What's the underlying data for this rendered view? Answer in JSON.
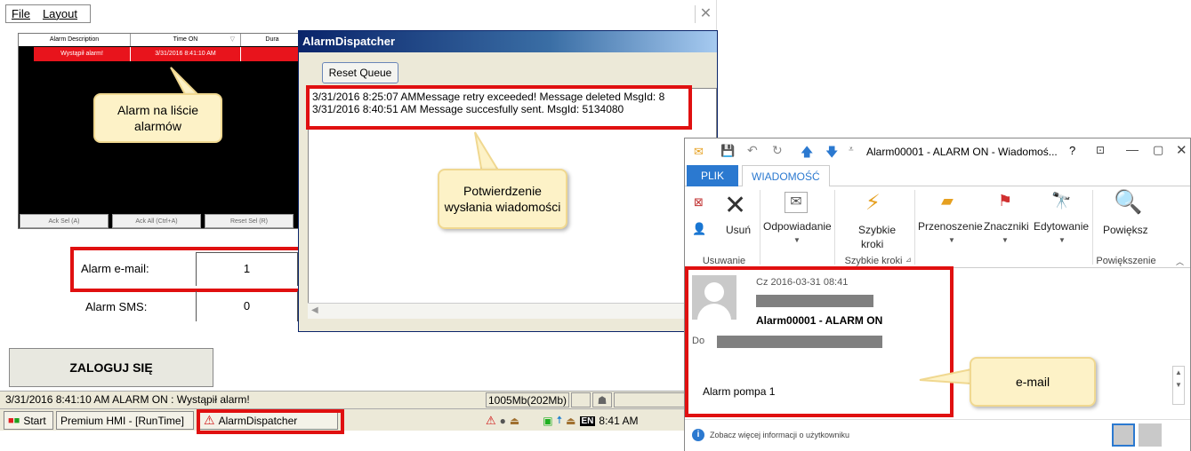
{
  "hmi": {
    "menu": {
      "file": "File",
      "layout": "Layout"
    },
    "close_glyph": "✕",
    "alarm_table": {
      "headers": [
        "Alarm Description",
        "Time ON",
        "Dura"
      ],
      "row": {
        "description": "Wystąpił alarm!",
        "time_on": "3/31/2016 8:41:10 AM"
      },
      "buttons": [
        "Ack Sel (A)",
        "Ack All (Ctrl+A)",
        "Reset Sel (R)"
      ]
    },
    "callout_alarm_list": "Alarm na liście alarmów",
    "callout_confirm": "Potwierdzenie wysłania wiadomości",
    "callout_email": "e-mail",
    "alarm_email_label": "Alarm e-mail:",
    "alarm_email_value": "1",
    "alarm_sms_label": "Alarm SMS:",
    "alarm_sms_value": "0",
    "login_button": "ZALOGUJ SIĘ",
    "status_text": "3/31/2016 8:41:10 AM ALARM ON : Wystąpił alarm!",
    "status_memory": "1005Mb(202Mb)"
  },
  "taskbar": {
    "start": "Start",
    "items": [
      "Premium HMI - [RunTime]",
      "AlarmDispatcher"
    ],
    "lang": "EN",
    "clock": "8:41 AM"
  },
  "dispatcher": {
    "title": "AlarmDispatcher",
    "reset_button": "Reset Queue",
    "log": [
      "3/31/2016 8:25:07 AMMessage retry exceeded! Message deleted MsgId: 8",
      "3/31/2016 8:40:51 AM Message succesfully sent. MsgId: 5134080"
    ]
  },
  "outlook": {
    "title": "Alarm00001 - ALARM ON - Wiadomoś...",
    "help": "?",
    "tabs": [
      "PLIK",
      "WIADOMOŚĆ"
    ],
    "ribbon": {
      "delete": "Usuń",
      "respond": "Odpowiadanie",
      "quick_steps_1": "Szybkie",
      "quick_steps_2": "kroki",
      "move": "Przenoszenie",
      "tags": "Znaczniki",
      "editing": "Edytowanie",
      "zoom": "Powiększ",
      "group_delete": "Usuwanie",
      "group_quick": "Szybkie kroki",
      "group_zoom": "Powiększenie"
    },
    "message": {
      "date": "Cz 2016-03-31 08:41",
      "subject": "Alarm00001 - ALARM ON",
      "to_label": "Do",
      "body": "Alarm pompa 1"
    },
    "footer_text": "Zobacz więcej informacji o użytkowniku"
  },
  "colors": {
    "highlight_red": "#e01010",
    "alarm_row_red": "#e8141c",
    "outlook_blue": "#2b79d0",
    "callout_fill": "#fdf2c7"
  }
}
